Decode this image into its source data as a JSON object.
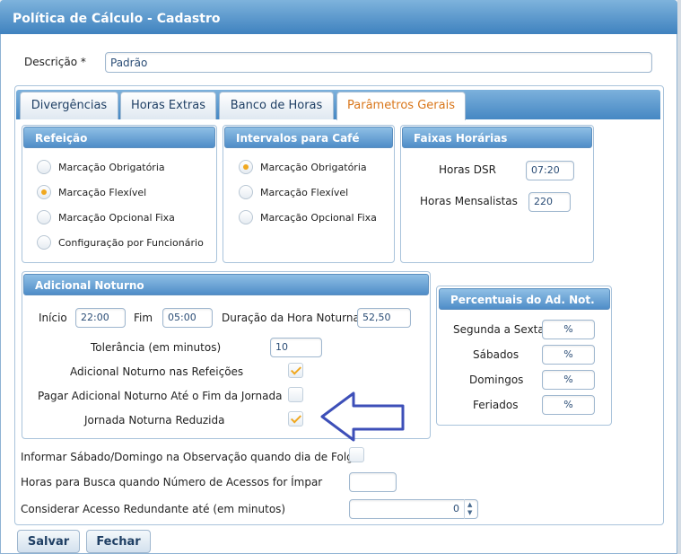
{
  "window": {
    "title": "Política de Cálculo - Cadastro"
  },
  "descricao": {
    "label": "Descrição *",
    "value": "Padrão"
  },
  "tabs": [
    {
      "label": "Divergências",
      "active": false
    },
    {
      "label": "Horas Extras",
      "active": false
    },
    {
      "label": "Banco de Horas",
      "active": false
    },
    {
      "label": "Parâmetros Gerais",
      "active": true
    }
  ],
  "refeicao": {
    "title": "Refeição",
    "options": [
      {
        "label": "Marcação Obrigatória",
        "selected": false
      },
      {
        "label": "Marcação Flexível",
        "selected": true
      },
      {
        "label": "Marcação Opcional Fixa",
        "selected": false
      },
      {
        "label": "Configuração por Funcionário",
        "selected": false
      }
    ]
  },
  "intervalos_cafe": {
    "title": "Intervalos para Café",
    "options": [
      {
        "label": "Marcação Obrigatória",
        "selected": true
      },
      {
        "label": "Marcação Flexível",
        "selected": false
      },
      {
        "label": "Marcação Opcional Fixa",
        "selected": false
      }
    ]
  },
  "faixas_horarias": {
    "title": "Faixas Horárias",
    "horas_dsr": {
      "label": "Horas DSR",
      "value": "07:20"
    },
    "horas_mensalistas": {
      "label": "Horas Mensalistas",
      "value": "220"
    }
  },
  "adicional_noturno": {
    "title": "Adicional Noturno",
    "inicio": {
      "label": "Início",
      "value": "22:00"
    },
    "fim": {
      "label": "Fim",
      "value": "05:00"
    },
    "duracao": {
      "label": "Duração da Hora Noturna",
      "value": "52,50"
    },
    "tolerancia": {
      "label": "Tolerância (em minutos)",
      "value": "10"
    },
    "nas_refeicoes": {
      "label": "Adicional Noturno nas Refeições",
      "checked": true
    },
    "ate_fim_jornada": {
      "label": "Pagar Adicional Noturno Até o Fim da Jornada",
      "checked": false
    },
    "jornada_reduzida": {
      "label": "Jornada Noturna Reduzida",
      "checked": true
    }
  },
  "percentuais": {
    "title": "Percentuais do Ad. Not.",
    "unit": "%",
    "rows": [
      {
        "label": "Segunda a Sexta",
        "value": ""
      },
      {
        "label": "Sábados",
        "value": ""
      },
      {
        "label": "Domingos",
        "value": ""
      },
      {
        "label": "Feriados",
        "value": ""
      }
    ]
  },
  "informar_sabado_domingo": {
    "label": "Informar Sábado/Domingo na Observação quando dia de Folga",
    "checked": false
  },
  "horas_busca": {
    "label": "Horas para Busca quando Número de Acessos for Ímpar",
    "value": ""
  },
  "acesso_redundante": {
    "label": "Considerar Acesso Redundante até (em minutos)",
    "value": "0"
  },
  "buttons": {
    "save": "Salvar",
    "close": "Fechar"
  },
  "colors": {
    "header_blue": "#4f8dc8",
    "accent_orange": "#d9761a",
    "arrow_blue": "#3d4fb8"
  }
}
